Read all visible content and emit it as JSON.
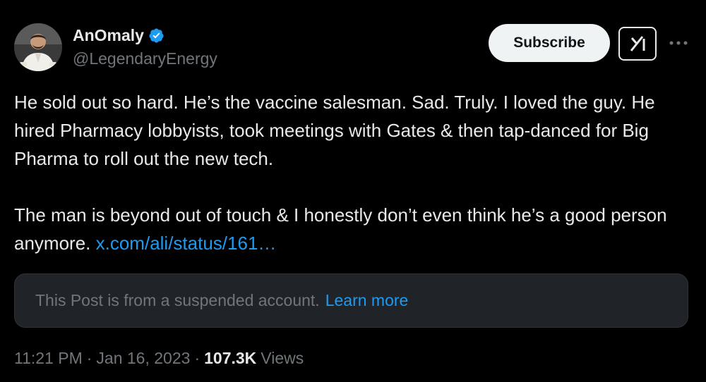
{
  "author": {
    "display_name": "AnOmaly",
    "handle": "@LegendaryEnergy",
    "verified": true,
    "avatar_icon": "profile-photo"
  },
  "actions": {
    "subscribe_label": "Subscribe",
    "grok_icon": "grok-icon",
    "more_icon": "more-dots-icon"
  },
  "tweet": {
    "paragraph_1": "He sold out so hard. He’s the vaccine salesman. Sad. Truly. I loved the guy. He hired Pharmacy lobbyists, took meetings with Gates & then tap-danced for Big Pharma to roll out the new tech.",
    "paragraph_2_text": "The man is beyond out of touch & I honestly don’t even think he’s a good person anymore.",
    "link_text": "x.com/ali/status/161…"
  },
  "notice": {
    "text": "This Post is from a suspended account.",
    "learn_more": "Learn more"
  },
  "meta": {
    "time": "11:21 PM",
    "date": "Jan 16, 2023",
    "views_count": "107.3K",
    "views_label": "Views"
  },
  "colors": {
    "background": "#000000",
    "text": "#e7e9ea",
    "secondary": "#71767b",
    "link": "#1d9bf0",
    "verified": "#1d9bf0"
  }
}
